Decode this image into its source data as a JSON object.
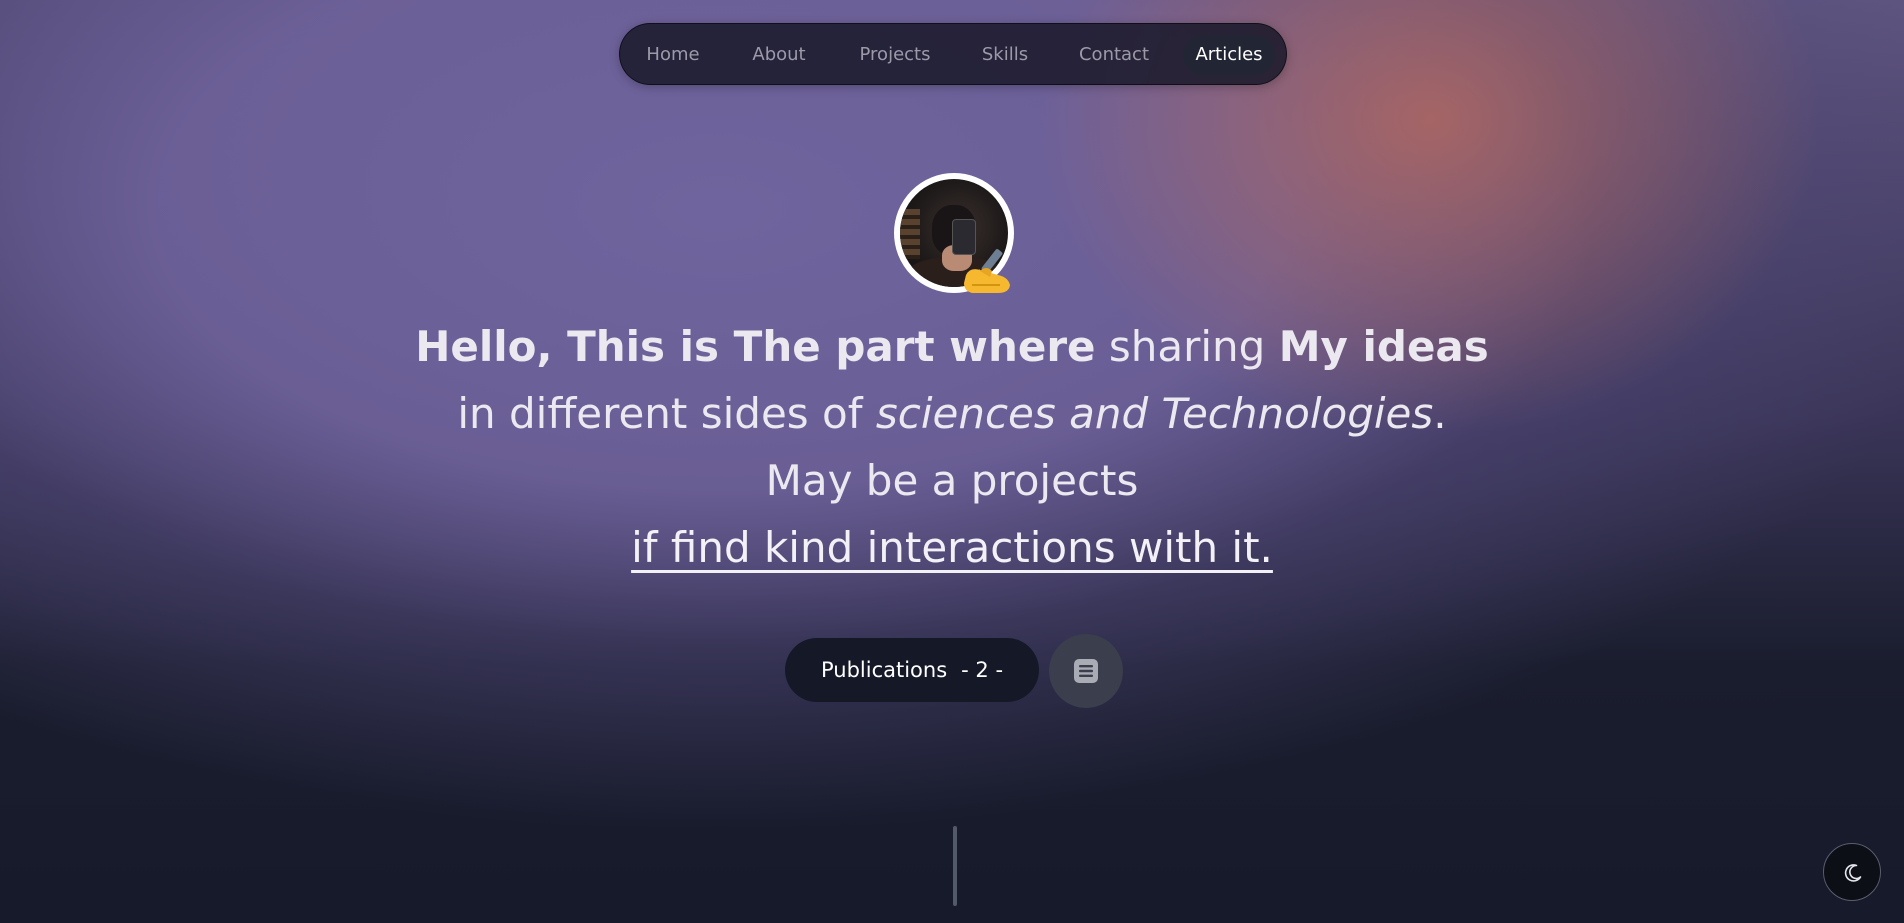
{
  "nav": {
    "items": [
      {
        "label": "Home",
        "active": false
      },
      {
        "label": "About",
        "active": false
      },
      {
        "label": "Projects",
        "active": false
      },
      {
        "label": "Skills",
        "active": false
      },
      {
        "label": "Contact",
        "active": false
      },
      {
        "label": "Articles",
        "active": true
      }
    ]
  },
  "hero": {
    "avatar_emoji": "writing-hand-emoji",
    "line1_bold_a": "Hello, This is The part where",
    "line1_normal": " sharing ",
    "line1_bold_b": "My ideas",
    "line2_normal": "in different sides of ",
    "line2_italic": "sciences and Technologies",
    "line2_end": ".",
    "line3": "May be a projects",
    "line4_link": "if find kind interactions with it."
  },
  "publications": {
    "label": "Publications",
    "count": "- 2 -",
    "icon": "article-list-icon"
  },
  "theme_toggle": {
    "icon": "moon-icon"
  },
  "colors": {
    "accent_active_nav": "#222634",
    "button_dark": "#141827",
    "page_bg": "#161a2a"
  }
}
